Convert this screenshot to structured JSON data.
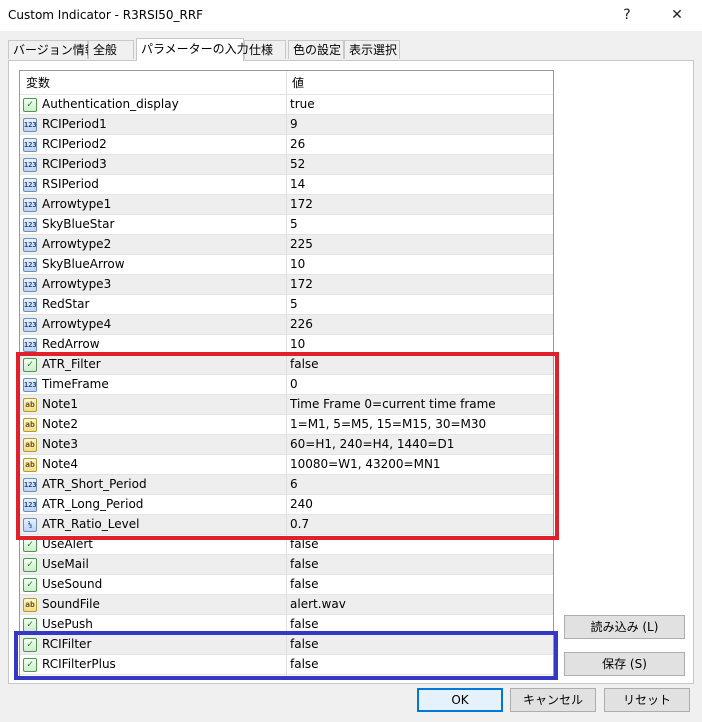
{
  "window": {
    "title": "Custom Indicator - R3RSI50_RRF",
    "help_glyph": "?",
    "close_glyph": "✕"
  },
  "tabs": [
    {
      "label": "バージョン情報",
      "active": false
    },
    {
      "label": "全般",
      "active": false
    },
    {
      "label": "パラメーターの入力",
      "active": true
    },
    {
      "label": "仕様",
      "active": false
    },
    {
      "label": "色の設定",
      "active": false
    },
    {
      "label": "表示選択",
      "active": false
    }
  ],
  "grid": {
    "columns": [
      "変数",
      "値"
    ],
    "rows": [
      {
        "name": "Authentication_display",
        "value": "true",
        "type": "bool"
      },
      {
        "name": "RCIPeriod1",
        "value": "9",
        "type": "int"
      },
      {
        "name": "RCIPeriod2",
        "value": "26",
        "type": "int"
      },
      {
        "name": "RCIPeriod3",
        "value": "52",
        "type": "int"
      },
      {
        "name": "RSIPeriod",
        "value": "14",
        "type": "int"
      },
      {
        "name": "Arrowtype1",
        "value": "172",
        "type": "int"
      },
      {
        "name": "SkyBlueStar",
        "value": "5",
        "type": "int"
      },
      {
        "name": "Arrowtype2",
        "value": "225",
        "type": "int"
      },
      {
        "name": "SkyBlueArrow",
        "value": "10",
        "type": "int"
      },
      {
        "name": "Arrowtype3",
        "value": "172",
        "type": "int"
      },
      {
        "name": "RedStar",
        "value": "5",
        "type": "int"
      },
      {
        "name": "Arrowtype4",
        "value": "226",
        "type": "int"
      },
      {
        "name": "RedArrow",
        "value": "10",
        "type": "int"
      },
      {
        "name": "ATR_Filter",
        "value": "false",
        "type": "bool"
      },
      {
        "name": "TimeFrame",
        "value": "0",
        "type": "int"
      },
      {
        "name": "Note1",
        "value": "Time Frame 0=current time frame",
        "type": "str"
      },
      {
        "name": "Note2",
        "value": "1=M1, 5=M5, 15=M15, 30=M30",
        "type": "str"
      },
      {
        "name": "Note3",
        "value": "60=H1, 240=H4, 1440=D1",
        "type": "str"
      },
      {
        "name": "Note4",
        "value": "10080=W1, 43200=MN1",
        "type": "str"
      },
      {
        "name": "ATR_Short_Period",
        "value": "6",
        "type": "int"
      },
      {
        "name": "ATR_Long_Period",
        "value": "240",
        "type": "int"
      },
      {
        "name": "ATR_Ratio_Level",
        "value": "0.7",
        "type": "dbl"
      },
      {
        "name": "UseAlert",
        "value": "false",
        "type": "bool"
      },
      {
        "name": "UseMail",
        "value": "false",
        "type": "bool"
      },
      {
        "name": "UseSound",
        "value": "false",
        "type": "bool"
      },
      {
        "name": "SoundFile",
        "value": "alert.wav",
        "type": "str"
      },
      {
        "name": "UsePush",
        "value": "false",
        "type": "bool"
      },
      {
        "name": "RCIFilter",
        "value": "false",
        "type": "bool"
      },
      {
        "name": "RCIFilterPlus",
        "value": "false",
        "type": "bool"
      }
    ]
  },
  "icons": {
    "int": "123",
    "bool": "✓",
    "str": "ab",
    "dbl": "½"
  },
  "side_buttons": {
    "load": "読み込み (L)",
    "save": "保存 (S)"
  },
  "footer_buttons": {
    "ok": "OK",
    "cancel": "キャンセル",
    "reset": "リセット"
  },
  "highlight_colors": {
    "red": "#e0202a",
    "blue": "#3438c4"
  }
}
